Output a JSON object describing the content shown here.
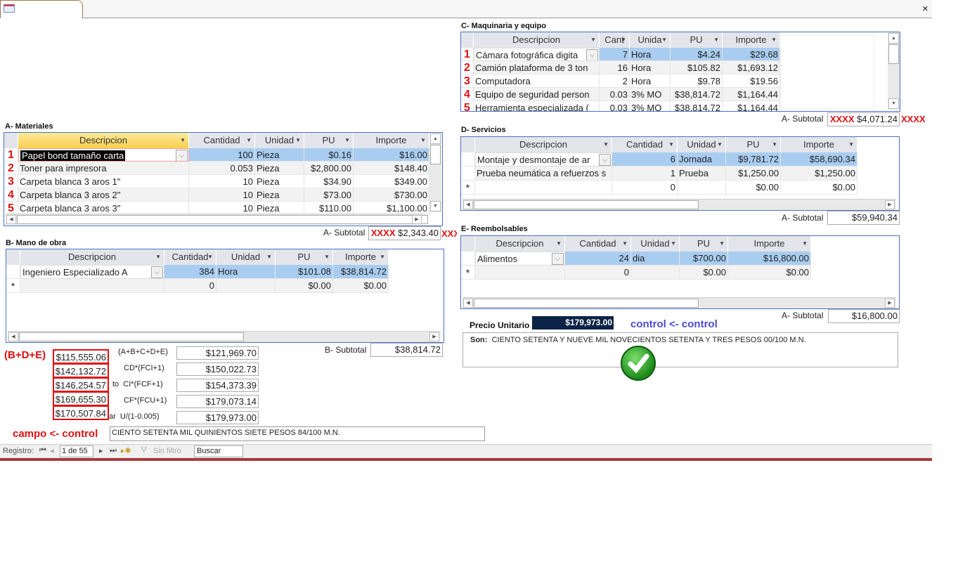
{
  "window": {
    "icon": "form-icon",
    "close": "×"
  },
  "materiales": {
    "title": "A- Materiales",
    "columns": [
      "Descripcion",
      "Cantidad",
      "Unidad",
      "PU",
      "Importe"
    ],
    "rows": [
      [
        "1",
        "Papel bond tamaño carta",
        "100",
        "Pieza",
        "$0.16",
        "$16.00"
      ],
      [
        "2",
        "Toner para impresora",
        "0.053",
        "Pieza",
        "$2,800.00",
        "$148.40"
      ],
      [
        "3",
        "Carpeta blanca 3 aros 1\"",
        "10",
        "Pieza",
        "$34.90",
        "$349.00"
      ],
      [
        "4",
        "Carpeta blanca 3 aros 2\"",
        "10",
        "Pieza",
        "$73.00",
        "$730.00"
      ],
      [
        "5",
        "Carpeta blanca 3 aros 3\"",
        "10",
        "Pieza",
        "$110.00",
        "$1,100.00"
      ]
    ],
    "subtotal_label": "A- Subtotal",
    "subtotal": "$2,343.40",
    "marker_left": "XXXX",
    "marker_right": "XXX"
  },
  "mano_obra": {
    "title": "B- Mano de obra",
    "columns": [
      "Descripcion",
      "Cantidad",
      "Unidad",
      "PU",
      "Importe"
    ],
    "rows": [
      [
        "",
        "Ingeniero Especializado A",
        "384",
        "Hora",
        "$101.08",
        "$38,814.72"
      ],
      [
        "*",
        "",
        "0",
        "",
        "$0.00",
        "$0.00"
      ]
    ],
    "subtotal_label": "B- Subtotal",
    "subtotal": "$38,814.72"
  },
  "maquinaria": {
    "title": "C- Maquinaria y equipo",
    "columns": [
      "Descripcion",
      "Cant",
      "Unida",
      "PU",
      "Importe"
    ],
    "rows": [
      [
        "1",
        "Cámara fotográfica digita",
        "7",
        "Hora",
        "$4.24",
        "$29.68"
      ],
      [
        "2",
        "Camión plataforma de 3 ton",
        "16",
        "Hora",
        "$105.82",
        "$1,693.12"
      ],
      [
        "3",
        "Computadora",
        "2",
        "Hora",
        "$9.78",
        "$19.56"
      ],
      [
        "4",
        "Equipo de seguridad person",
        "0.03",
        "3% MO",
        "$38,814.72",
        "$1,164.44"
      ],
      [
        "5",
        "Herramienta especializada (",
        "0.03",
        "3% MO",
        "$38,814.72",
        "$1,164.44"
      ]
    ],
    "subtotal_label": "A- Subtotal",
    "subtotal": "$4,071.24",
    "marker_left": "XXXX",
    "marker_right": "XXXX"
  },
  "servicios": {
    "title": "D- Servicios",
    "columns": [
      "Descripcion",
      "Cantidad",
      "Unidad",
      "PU",
      "Importe"
    ],
    "rows": [
      [
        "",
        "Montaje y desmontaje de ar",
        "6",
        "Jornada",
        "$9,781.72",
        "$58,690.34"
      ],
      [
        "",
        "Prueba neumática a refuerzos s",
        "1",
        "Prueba",
        "$1,250.00",
        "$1,250.00"
      ],
      [
        "*",
        "",
        "0",
        "",
        "$0.00",
        "$0.00"
      ]
    ],
    "subtotal_label": "A- Subtotal",
    "subtotal": "$59,940.34"
  },
  "reembolsables": {
    "title": "E- Reembolsables",
    "columns": [
      "Descripcion",
      "Cantidad",
      "Unidad",
      "PU",
      "Importe"
    ],
    "rows": [
      [
        "",
        "Alimentos",
        "24",
        "dia",
        "$700.00",
        "$16,800.00"
      ],
      [
        "*",
        "",
        "0",
        "",
        "$0.00",
        "$0.00"
      ]
    ],
    "subtotal_label": "A- Subtotal",
    "subtotal": "$16,800.00"
  },
  "calc": {
    "group_label": "(B+D+E)",
    "control_values": [
      "$115,555.06",
      "$142,132.72",
      "$146,254.57",
      "$169,655.30",
      "$170,507.84"
    ],
    "formulas": [
      "(A+B+C+D+E)",
      "CD*(FCI+1)",
      "to  CI*(FCF+1)",
      "CF*(FCU+1)",
      "ar  U/(1-0.005)"
    ],
    "values": [
      "$121,969.70",
      "$150,022.73",
      "$154,373.39",
      "$179,073.14",
      "$179,973.00"
    ],
    "campo_label": "campo <- control",
    "campo_text": "CIENTO SETENTA MIL QUINIENTOS SIETE PESOS 84/100 M.N."
  },
  "precio": {
    "label": "Precio Unitario",
    "value": "$179,973.00",
    "control_label": "control <- control",
    "son_label": "Son:",
    "son_text": "CIENTO SETENTA Y NUEVE MIL NOVECIENTOS SETENTA Y TRES PESOS 00/100 M.N.",
    "check_icon": "green-check-icon"
  },
  "status": {
    "registro": "Registro:",
    "record": "1 de 55",
    "filter": "Sin filtro",
    "search": "Buscar"
  },
  "colors": {
    "accent_red": "#e01010",
    "control_blue": "#4a4ad0",
    "precio_bg": "#0b2346",
    "selected_row": "#a9cdf0",
    "grid_border": "#4a72c0",
    "status_bar": "#a83a3a"
  }
}
